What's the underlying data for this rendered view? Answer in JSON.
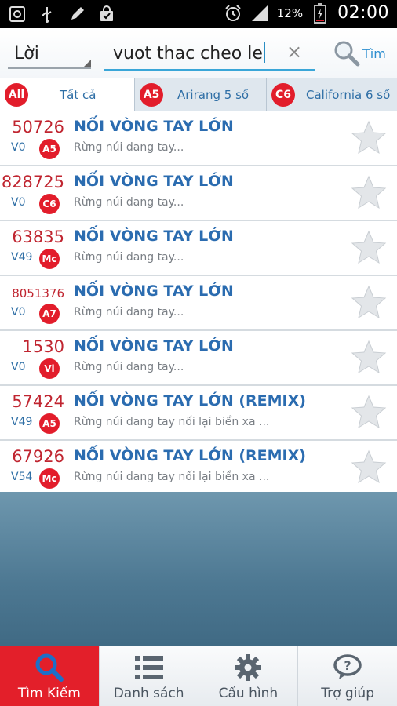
{
  "status_bar": {
    "battery_percent": "12%",
    "time": "02:00",
    "icons": [
      "gallery-icon",
      "usb-icon",
      "pencil-icon",
      "shopping-bag-icon",
      "alarm-icon",
      "signal-icon",
      "battery-icon"
    ]
  },
  "search": {
    "mode_label": "Lời",
    "query": "vuot thac cheo le",
    "clear_symbol": "×",
    "search_button_label": "Tìm"
  },
  "tabs": [
    {
      "badge": "All",
      "label": "Tất cả",
      "active": true
    },
    {
      "badge": "A5",
      "label": "Arirang 5 số",
      "active": false
    },
    {
      "badge": "C6",
      "label": "California 6 số",
      "active": false
    }
  ],
  "results": [
    {
      "code": "50726",
      "version": "V0",
      "badge": "A5",
      "title": "NỐI VÒNG TAY LỚN",
      "lyric": "Rừng núi dang tay..."
    },
    {
      "code": "828725",
      "version": "V0",
      "badge": "C6",
      "title": "NỐI VÒNG TAY LỚN",
      "lyric": "Rừng núi dang tay..."
    },
    {
      "code": "63835",
      "version": "V49",
      "badge": "Mc",
      "title": "NỐI VÒNG TAY LỚN",
      "lyric": "Rừng núi dang tay..."
    },
    {
      "code": "8051376",
      "version": "V0",
      "badge": "A7",
      "title": "NỐI VÒNG TAY LỚN",
      "lyric": "Rừng núi dang tay..."
    },
    {
      "code": "1530",
      "version": "V0",
      "badge": "Vi",
      "title": "NỐI VÒNG TAY LỚN",
      "lyric": "Rừng núi dang tay..."
    },
    {
      "code": "57424",
      "version": "V49",
      "badge": "A5",
      "title": "NỐI VÒNG TAY LỚN (REMIX)",
      "lyric": "Rừng núi dang tay nối lại biển xa ..."
    },
    {
      "code": "67926",
      "version": "V54",
      "badge": "Mc",
      "title": "NỐI VÒNG TAY LỚN (REMIX)",
      "lyric": "Rừng núi dang tay nối lại biển xa ..."
    }
  ],
  "bottom_nav": [
    {
      "label": "Tìm Kiếm",
      "icon": "search-icon",
      "active": true
    },
    {
      "label": "Danh sách",
      "icon": "list-icon",
      "active": false
    },
    {
      "label": "Cấu hình",
      "icon": "gear-icon",
      "active": false
    },
    {
      "label": "Trợ giúp",
      "icon": "help-icon",
      "active": false
    }
  ],
  "colors": {
    "accent_red": "#e21d2b",
    "title_blue": "#2b6cb0",
    "code_red": "#c02530",
    "empty_area": "#4d7892"
  }
}
